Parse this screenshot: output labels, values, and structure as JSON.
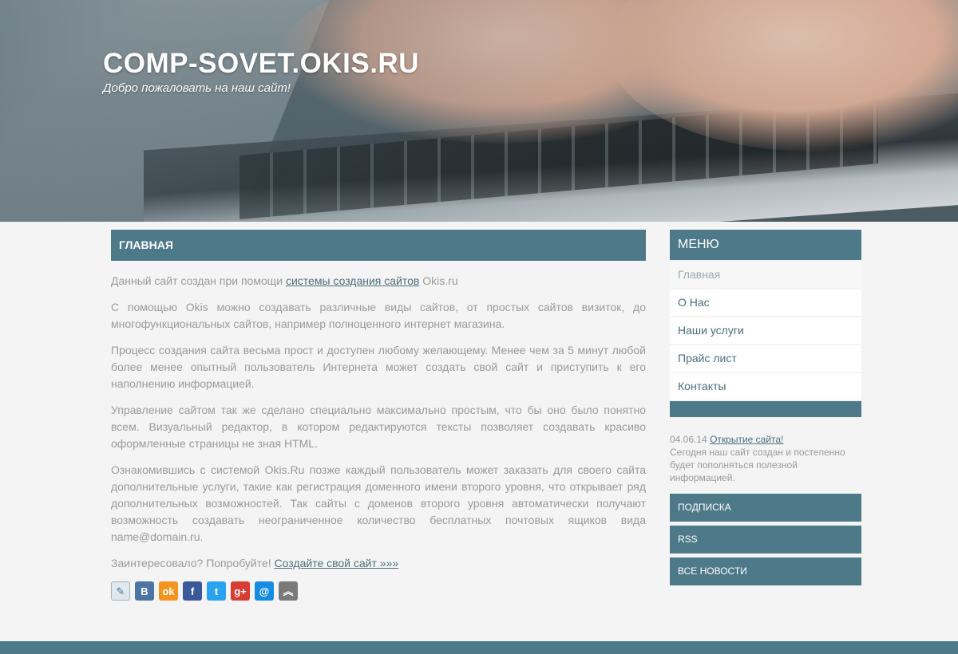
{
  "header": {
    "title": "COMP-SOVET.OKIS.RU",
    "tagline": "Добро пожаловать на наш сайт!"
  },
  "main": {
    "section_title": "ГЛАВНАЯ",
    "p1_before": "Данный сайт создан при помощи ",
    "p1_link": "системы создания сайтов",
    "p1_after": " Okis.ru",
    "p2": "С помощью Okis можно создавать различные виды сайтов, от простых сайтов визиток, до многофункциональных сайтов, например полноценного интернет магазина.",
    "p3": "Процесс создания сайта весьма прост и доступен любому желающему. Менее чем за 5 минут любой более менее опытный пользователь Интернета может создать свой сайт и приступить к его наполнению информацией.",
    "p4": "Управление сайтом так же сделано специально максимально простым, что бы оно было понятно всем. Визуальный редактор, в котором редактируются тексты позволяет создавать красиво оформленные страницы не зная HTML.",
    "p5": "Ознакомившись с системой Okis.Ru позже каждый пользователь может заказать для своего сайта дополнительные услуги, такие как регистрация доменного имени второго уровня, что открывает ряд дополнительных возможностей. Так сайты с доменов второго уровня автоматически получают возможность создавать неограниченное количество бесплатных почтовых ящиков вида name@domain.ru.",
    "p6_before": "Заинтересовало? Попробуйте! ",
    "p6_link": "Создайте свой сайт »»»"
  },
  "social": [
    {
      "name": "livejournal-icon",
      "glyph": "✎",
      "color": "#dfe8ee"
    },
    {
      "name": "vkontakte-icon",
      "glyph": "В",
      "color": "#4d75a3"
    },
    {
      "name": "odnoklassniki-icon",
      "glyph": "ok",
      "color": "#f2941d"
    },
    {
      "name": "facebook-icon",
      "glyph": "f",
      "color": "#3b5998"
    },
    {
      "name": "twitter-icon",
      "glyph": "t",
      "color": "#2aa3ef"
    },
    {
      "name": "googleplus-icon",
      "glyph": "g+",
      "color": "#d73d32"
    },
    {
      "name": "mailru-icon",
      "glyph": "@",
      "color": "#168de2"
    },
    {
      "name": "more-share-icon",
      "glyph": "︽",
      "color": "#7a7a7a"
    }
  ],
  "sidebar": {
    "menu_title": "МЕНЮ",
    "items": [
      {
        "label": "Главная",
        "active": true
      },
      {
        "label": "О Нас",
        "active": false
      },
      {
        "label": "Наши услуги",
        "active": false
      },
      {
        "label": "Прайс лист",
        "active": false
      },
      {
        "label": "Контакты",
        "active": false
      }
    ],
    "news": {
      "date": "04.06.14",
      "title": "Открытие сайта!",
      "text": "Сегодня наш сайт создан и постепенно будет пополняться полезной информацией."
    },
    "buttons": [
      "ПОДПИСКА",
      "RSS",
      "ВСЕ НОВОСТИ"
    ]
  },
  "colors": {
    "accent": "#4e7989",
    "link": "#4b6f7c",
    "text": "#9a9a9a",
    "background": "#f4f4f4"
  }
}
